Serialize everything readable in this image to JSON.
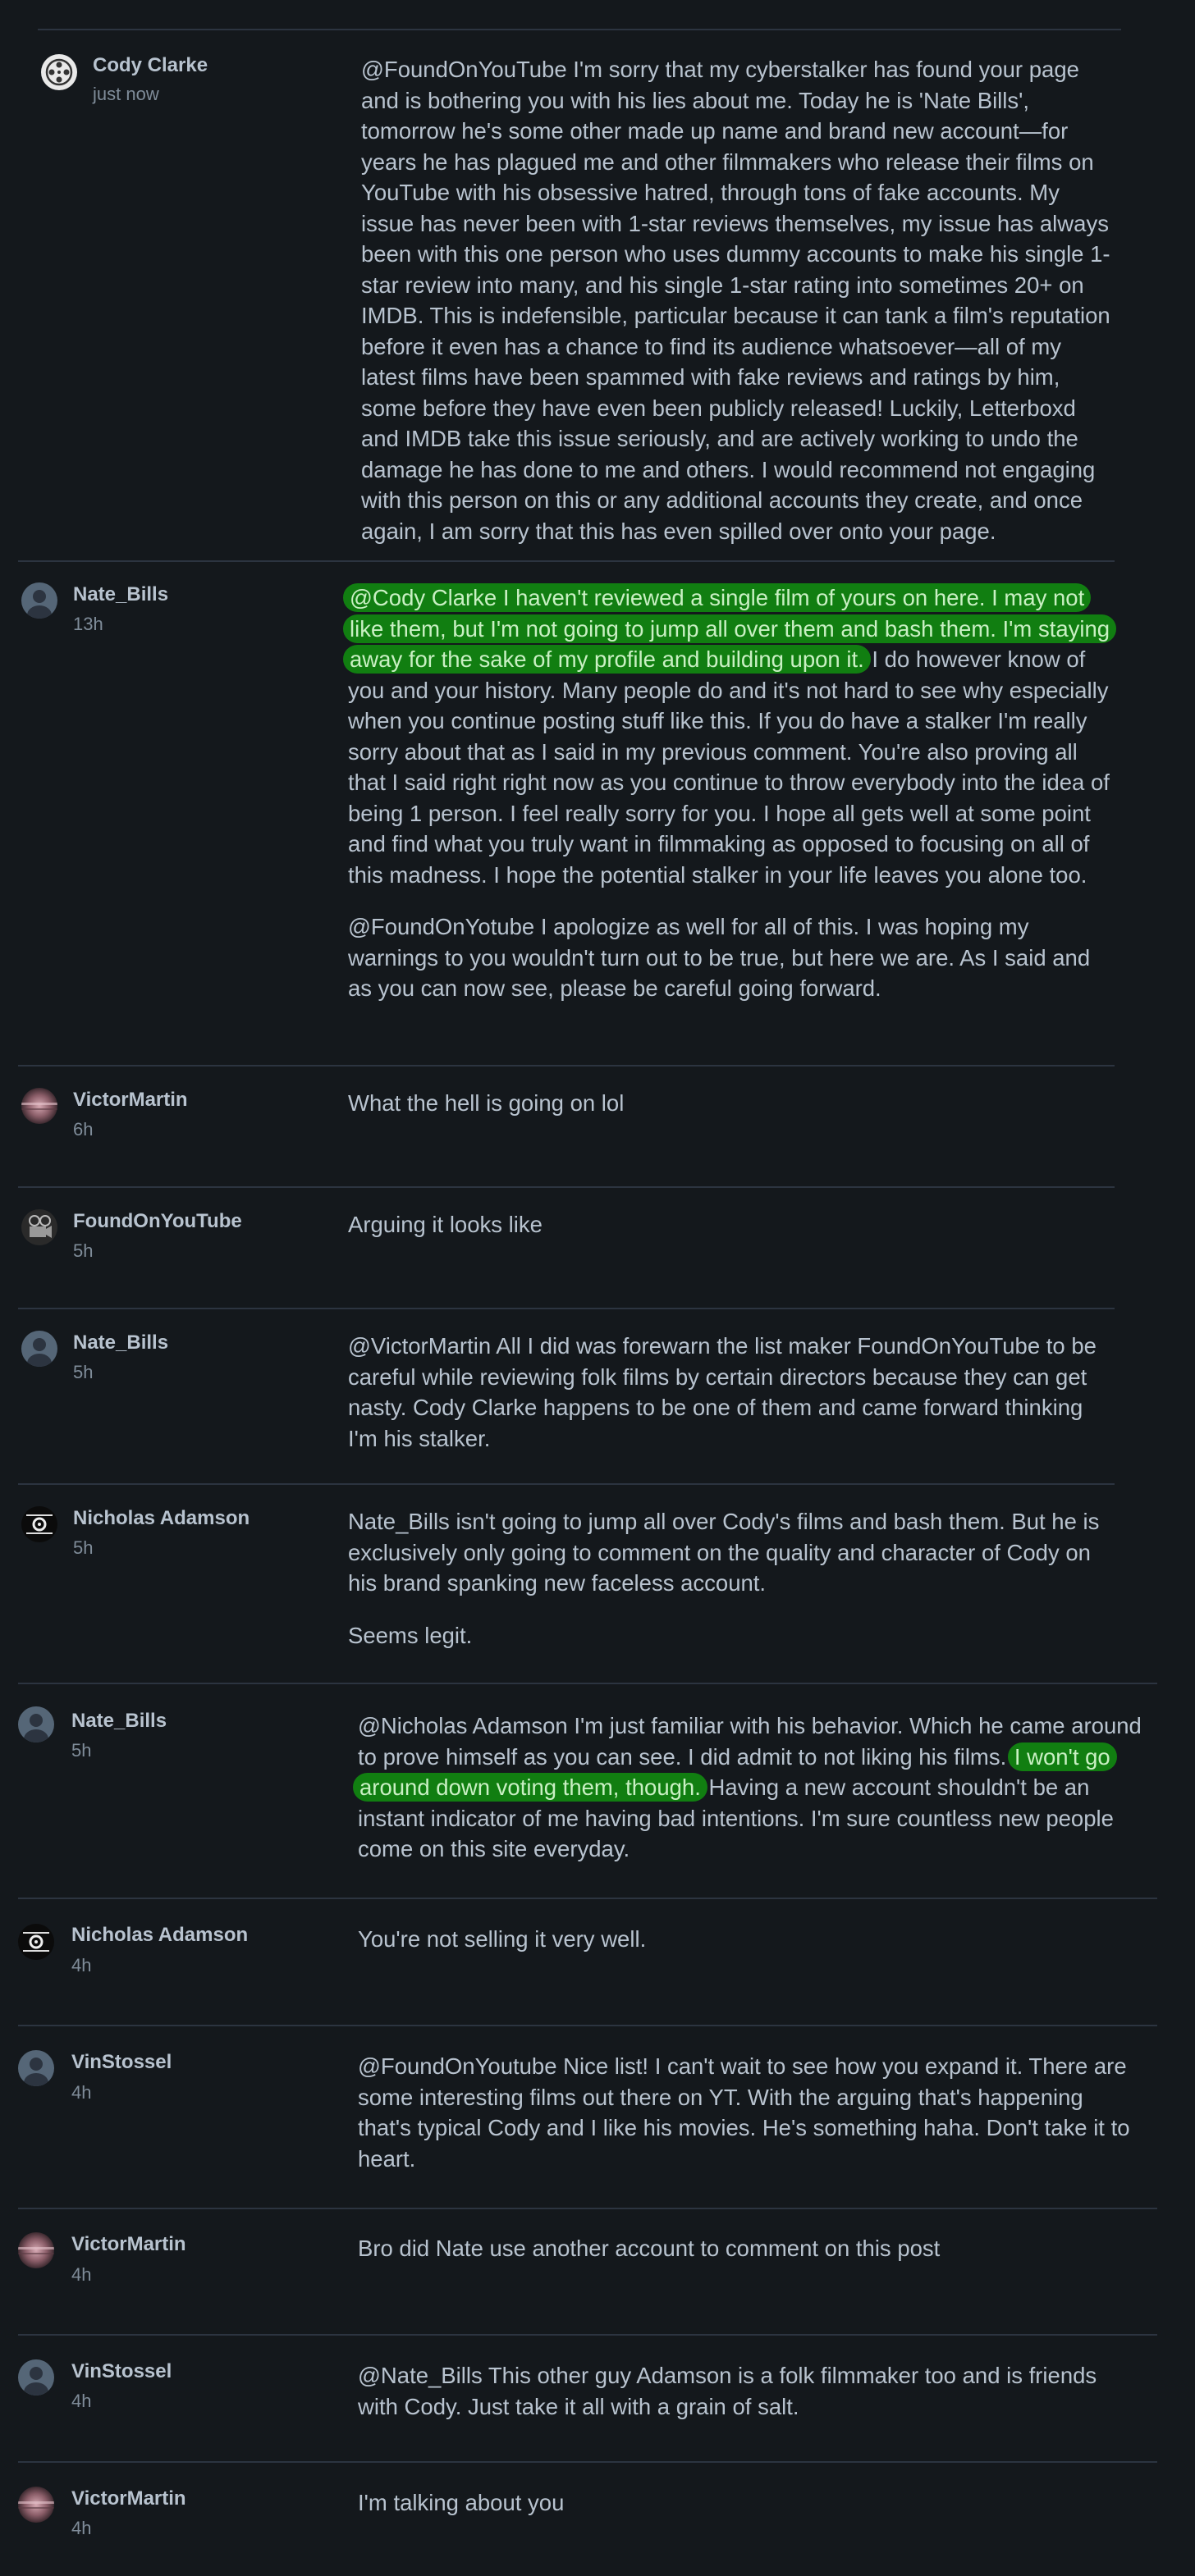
{
  "comments": [
    {
      "author": "Cody Clarke",
      "time": "just now",
      "avatar_icon": "film-reel-avatar-icon",
      "paragraphs": [
        "@FoundOnYouTube I'm sorry that my cyberstalker has found your page and is bothering you with his lies about me. Today he is 'Nate Bills', tomorrow he's some other made up name and brand new account—for years he has plagued me and other filmmakers who release their films on YouTube with his obsessive hatred, through tons of fake accounts. My issue has never been with 1-star reviews themselves, my issue has always been with this one person who uses dummy accounts to make his single 1-star review into many, and his single 1-star rating into sometimes 20+ on IMDB. This is indefensible, particular because it can tank a film's reputation before it even has a chance to find its audience whatsoever—all of my latest films have been spammed with fake reviews and ratings by him, some before they have even been publicly released! Luckily, Letterboxd and IMDB take this issue seriously, and are actively working to undo the damage he has done to me and others. I would recommend not engaging with this person on this or any additional accounts they create, and once again, I am sorry that this has even spilled over onto your page."
      ]
    },
    {
      "author": "Nate_Bills",
      "time": "13h",
      "avatar_icon": "default-user-avatar-icon",
      "p1_highlight": "@Cody Clarke I haven't reviewed a single film of yours on here. I may not like them, but I'm not going to jump all over them and bash them. I'm staying away for the sake of my profile and building upon it.",
      "p1_rest": " I do however know of you and your history. Many people do and it's not hard to see why especially when you continue posting stuff like this. If you do have a stalker I'm really sorry about that as I said in my previous comment. You're also proving all that I said right right now as you continue to throw everybody into the idea of being 1 person. I feel really sorry for you. I hope all gets well at some point and find what you truly want in filmmaking as opposed to focusing on all of this madness. I hope the potential stalker in your life leaves you alone too.",
      "p2": "@FoundOnYotube I apologize as well for all of this. I was hoping my warnings to you wouldn't turn out to be true, but here we are. As I said and as you can now see, please be careful going forward."
    },
    {
      "author": "VictorMartin",
      "time": "6h",
      "avatar_icon": "pink-blur-avatar-icon",
      "paragraphs": [
        "What the hell is going on lol"
      ]
    },
    {
      "author": "FoundOnYouTube",
      "time": "5h",
      "avatar_icon": "film-camera-avatar-icon",
      "paragraphs": [
        "Arguing it looks like"
      ]
    },
    {
      "author": "Nate_Bills",
      "time": "5h",
      "avatar_icon": "default-user-avatar-icon",
      "paragraphs": [
        "@VictorMartin All I did was forewarn the list maker FoundOnYouTube to be careful while reviewing folk films by certain directors because they can get nasty. Cody Clarke happens to be one of them and came forward thinking I'm his stalker."
      ]
    },
    {
      "author": "Nicholas Adamson",
      "time": "5h",
      "avatar_icon": "vhs-logo-avatar-icon",
      "paragraphs": [
        "Nate_Bills isn't going to jump all over Cody's films and bash them. But he is exclusively only going to comment on the quality and character of Cody on his brand spanking new faceless account.",
        "Seems legit."
      ]
    },
    {
      "author": "Nate_Bills",
      "time": "5h",
      "avatar_icon": "default-user-avatar-icon",
      "p1_pre": "@Nicholas Adamson I'm just familiar with his behavior. Which he came around to prove himself as you can see. I did admit to not liking his films. ",
      "p1_highlight": "I won't go around down voting them, though.",
      "p1_rest": " Having a new account shouldn't be an instant indicator of me having bad intentions. I'm sure countless new people come on this site everyday."
    },
    {
      "author": "Nicholas Adamson",
      "time": "4h",
      "avatar_icon": "vhs-logo-avatar-icon",
      "paragraphs": [
        "You're not selling it very well."
      ]
    },
    {
      "author": "VinStossel",
      "time": "4h",
      "avatar_icon": "default-user-avatar-icon",
      "paragraphs": [
        "@FoundOnYoutube Nice list! I can't wait to see how you expand it. There are some interesting films out there on YT. With the arguing that's happening that's typical Cody and I like his movies. He's something haha. Don't take it to heart."
      ]
    },
    {
      "author": "VictorMartin",
      "time": "4h",
      "avatar_icon": "pink-blur-avatar-icon",
      "paragraphs": [
        "Bro did Nate use another account to comment on this post"
      ]
    },
    {
      "author": "VinStossel",
      "time": "4h",
      "avatar_icon": "default-user-avatar-icon",
      "paragraphs": [
        "@Nate_Bills This other guy Adamson is a folk filmmaker too and is friends with Cody. Just take it all with a grain of salt."
      ]
    },
    {
      "author": "VictorMartin",
      "time": "4h",
      "avatar_icon": "pink-blur-avatar-icon",
      "paragraphs": [
        "I'm talking about you"
      ]
    }
  ]
}
